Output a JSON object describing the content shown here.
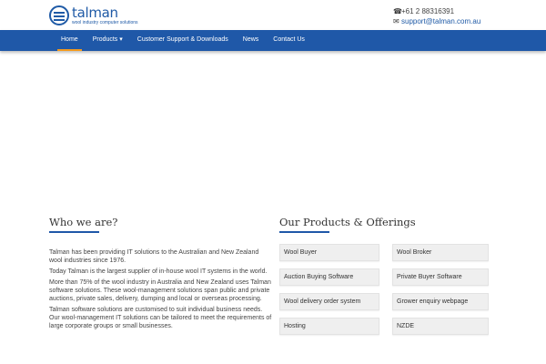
{
  "brand": {
    "name": "talman",
    "tagline": "wool industry computer solutions"
  },
  "contact": {
    "phone": "+61 2 88316391",
    "email": "support@talman.com.au",
    "phone_icon": "phone-icon",
    "email_icon": "envelope-icon"
  },
  "nav": {
    "items": [
      {
        "label": "Home"
      },
      {
        "label": "Products ▾"
      },
      {
        "label": "Customer Support & Downloads"
      },
      {
        "label": "News"
      },
      {
        "label": "Contact Us"
      }
    ],
    "active": "Home"
  },
  "about": {
    "title": "Who we are?",
    "paragraphs": [
      "Talman has been providing IT solutions to the Australian and New Zealand wool industries since 1976.",
      "Today Talman is the largest supplier of in-house wool IT systems in the world.",
      "More than 75% of the wool industry in Australia and New Zealand uses Talman software solutions. These wool-management solutions span public and private auctions, private sales, delivery, dumping and local or overseas processing.",
      "Talman software solutions are customised to suit individual business needs. Our wool-management IT solutions can be tailored to meet the requirements of large corporate groups or small businesses."
    ]
  },
  "products": {
    "title": "Our Products & Offerings",
    "items": [
      "Wool Buyer",
      "Wool Broker",
      "Auction Buying Software",
      "Private Buyer Software",
      "Wool delivery order system",
      "Grower enquiry webpage",
      "Hosting",
      "NZDE"
    ]
  },
  "colors": {
    "brand_blue": "#1f58a8",
    "active_underline": "#f39a1e"
  }
}
